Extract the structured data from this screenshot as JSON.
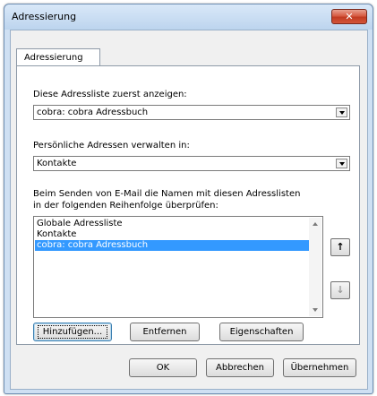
{
  "window": {
    "title": "Adressierung"
  },
  "tabs": [
    {
      "label": "Adressierung"
    }
  ],
  "first_list": {
    "label": "Diese Adressliste zuerst anzeigen:",
    "value": "cobra: cobra Adressbuch"
  },
  "personal": {
    "label": "Persönliche Adressen verwalten in:",
    "value": "Kontakte"
  },
  "check_order": {
    "label_line1": "Beim Senden von E-Mail die Namen mit diesen Adresslisten",
    "label_line2": "in der folgenden Reihenfolge überprüfen:",
    "items": [
      "Globale Adressliste",
      "Kontakte",
      "cobra: cobra Adressbuch"
    ],
    "selected_index": 2,
    "up_glyph": "↑",
    "down_glyph": "↓"
  },
  "actions": {
    "add": "Hinzufügen...",
    "remove": "Entfernen",
    "properties": "Eigenschaften"
  },
  "footer": {
    "ok": "OK",
    "cancel": "Abbrechen",
    "apply": "Übernehmen"
  },
  "colors": {
    "selection": "#3399ff",
    "close_button": "#c23b22",
    "frame": "#cfe0f3"
  }
}
